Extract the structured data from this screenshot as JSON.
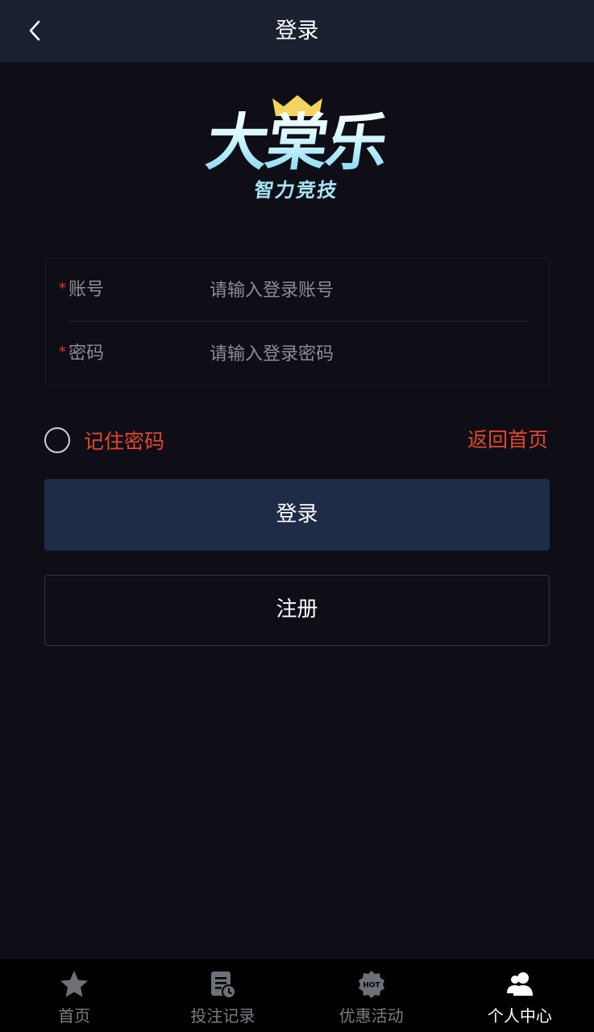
{
  "header": {
    "title": "登录",
    "back_icon": "chevron-left-icon"
  },
  "logo": {
    "title": "大棠乐",
    "subtitle": "智力竞技"
  },
  "form": {
    "account": {
      "required_mark": "*",
      "label": "账号",
      "placeholder": "请输入登录账号",
      "value": ""
    },
    "password": {
      "required_mark": "*",
      "label": "密码",
      "placeholder": "请输入登录密码",
      "value": ""
    }
  },
  "options": {
    "remember_label": "记住密码",
    "remember_checked": false,
    "back_home_label": "返回首页"
  },
  "buttons": {
    "login_label": "登录",
    "register_label": "注册"
  },
  "tabbar": {
    "items": [
      {
        "label": "首页",
        "icon": "star-icon",
        "active": false
      },
      {
        "label": "投注记录",
        "icon": "bet-record-icon",
        "active": false
      },
      {
        "label": "优惠活动",
        "icon": "hot-badge-icon",
        "active": false
      },
      {
        "label": "个人中心",
        "icon": "user-group-icon",
        "active": true
      }
    ]
  },
  "colors": {
    "background": "#0f0e16",
    "header": "#1a2130",
    "accent_red": "#e5452b",
    "login_button": "#1f2c47",
    "tab_inactive": "#7b7d85",
    "tab_active": "#ffffff"
  }
}
